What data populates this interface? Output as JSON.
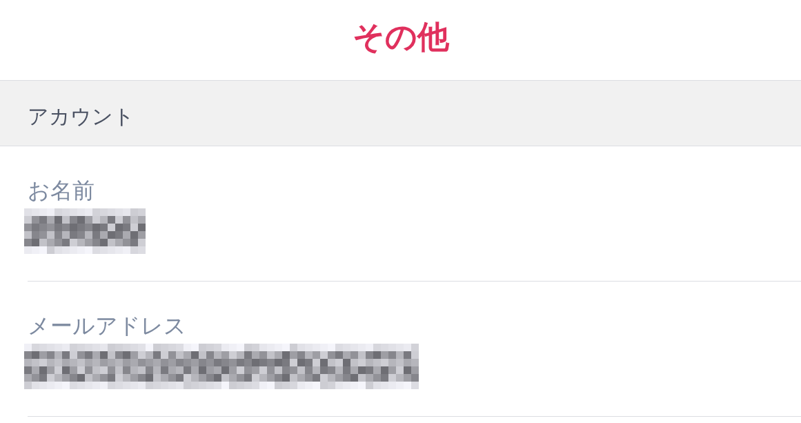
{
  "header": {
    "title": "その他"
  },
  "sections": [
    {
      "title": "アカウント",
      "fields": [
        {
          "label": "お名前",
          "redacted": true
        },
        {
          "label": "メールアドレス",
          "redacted": true
        }
      ]
    }
  ]
}
